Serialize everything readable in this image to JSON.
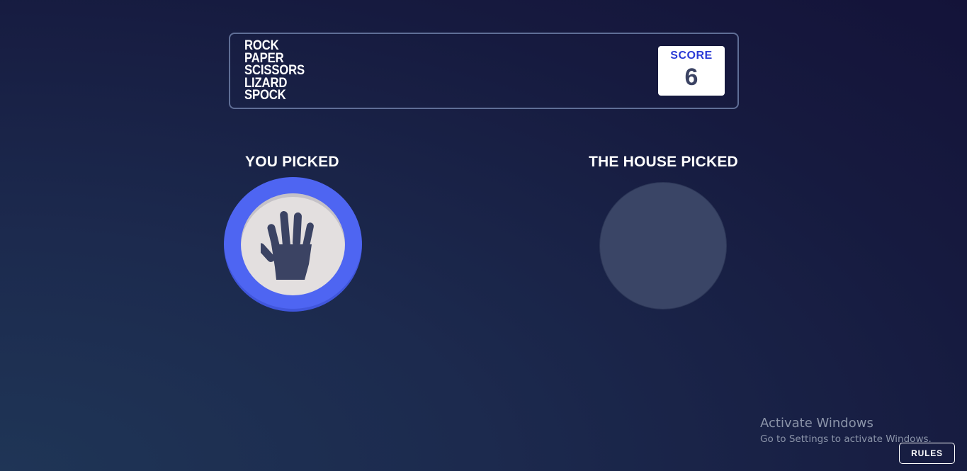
{
  "header": {
    "title_lines": [
      "ROCK",
      "PAPER",
      "SCISSORS",
      "LIZARD",
      "SPOCK"
    ],
    "score_label": "SCORE",
    "score_value": "6"
  },
  "game": {
    "you_picked_label": "YOU PICKED",
    "house_picked_label": "THE HOUSE PICKED",
    "player_choice": "paper",
    "player_icon": "hand-paper-icon",
    "player_ring_color": "#4e65f2",
    "house_choice": null
  },
  "watermark": {
    "title": "Activate Windows",
    "subtitle": "Go to Settings to activate Windows."
  },
  "footer": {
    "rules_label": "RULES"
  }
}
